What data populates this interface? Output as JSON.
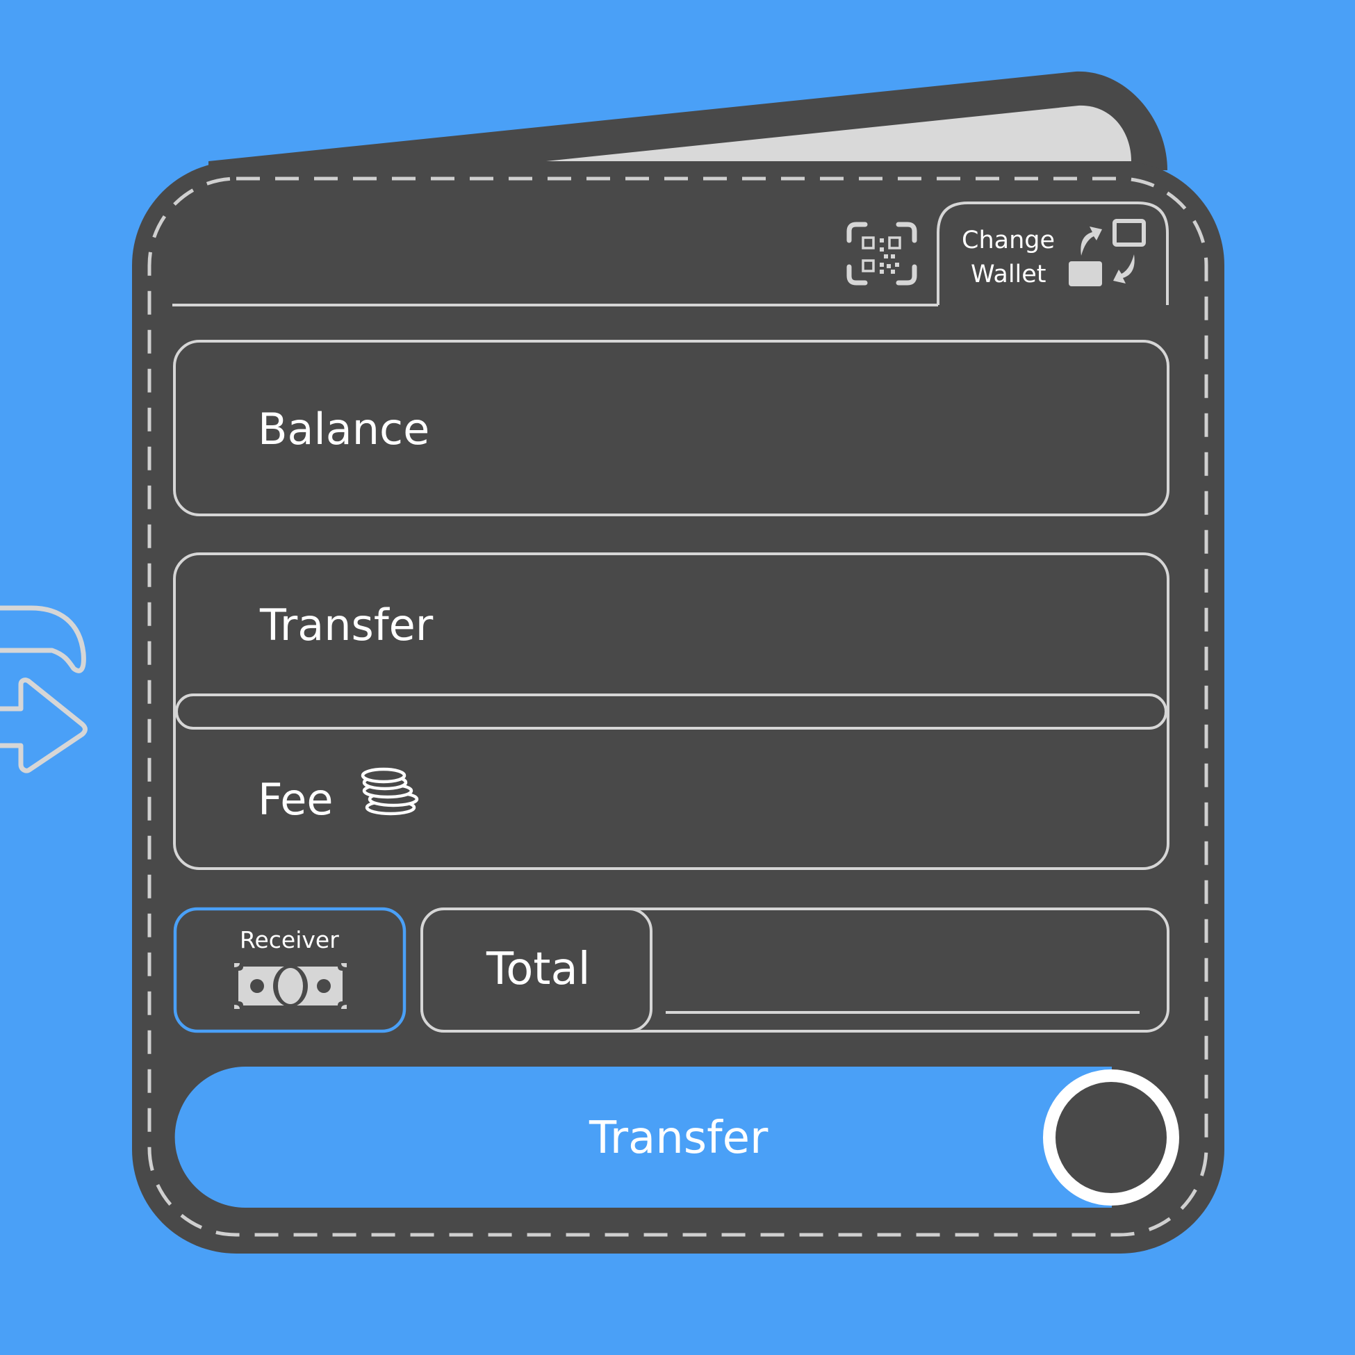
{
  "header": {
    "qr_icon": "qr-scan-icon",
    "change_wallet": {
      "line1": "Change",
      "line2": "Wallet",
      "icon": "swap-wallet-icon"
    }
  },
  "fields": {
    "balance_label": "Balance",
    "transfer_label": "Transfer",
    "fee_label": "Fee",
    "fee_icon": "coins-icon"
  },
  "receiver": {
    "label": "Receiver",
    "icon": "banknote-icon"
  },
  "total": {
    "label": "Total"
  },
  "transfer_button": {
    "label": "Transfer"
  },
  "side": {
    "icon": "transfer-arrow-icon"
  },
  "colors": {
    "background": "#4aa0f7",
    "wallet": "#494949",
    "outline": "#d6d6d6",
    "accent": "#4aa0f7",
    "text": "#ffffff"
  }
}
